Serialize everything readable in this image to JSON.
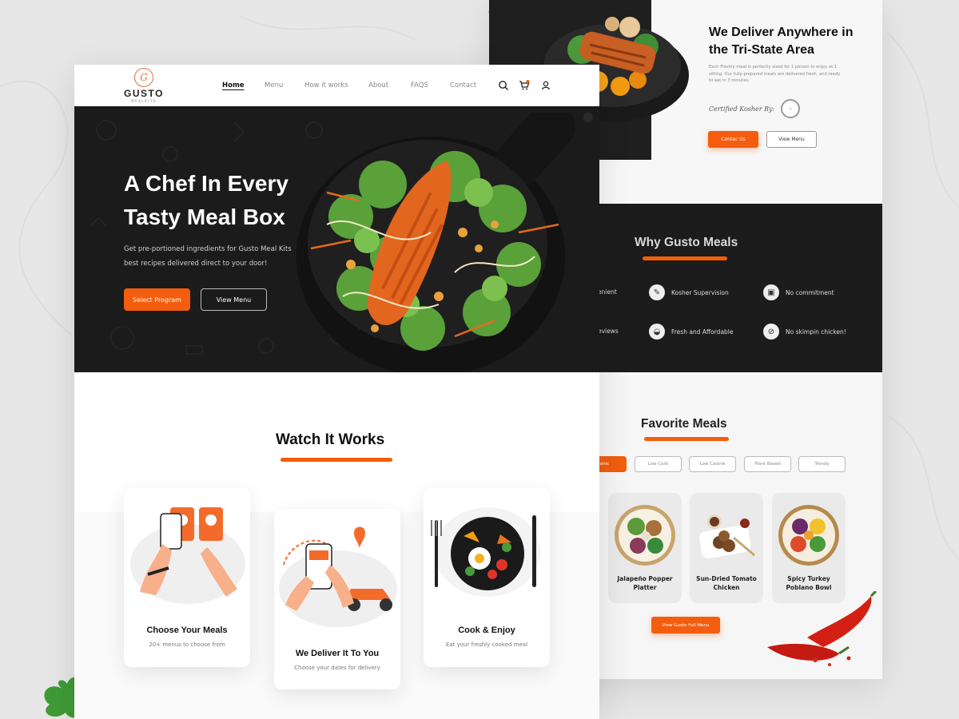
{
  "colors": {
    "accent": "#f35d0d",
    "dark": "#1b1b1b",
    "background": "#e7e7e7"
  },
  "brand": {
    "initial": "G",
    "name": "GUSTO",
    "tagline": "MEALKITS"
  },
  "nav": {
    "links": [
      "Home",
      "Menu",
      "How it works",
      "About",
      "FAQS",
      "Contact"
    ],
    "active": "Home",
    "icons": [
      "search-icon",
      "cart-icon",
      "user-icon"
    ]
  },
  "hero": {
    "title": "A Chef In Every Tasty Meal Box",
    "subtitle": "Get pre-portioned ingredients for Gusto Meal Kits best recipes delivered direct to your door!",
    "primary_button": "Select Program",
    "secondary_button": "View Menu"
  },
  "watch": {
    "title": "Watch It Works",
    "steps": [
      {
        "title": "Choose Your Meals",
        "subtitle": "20+ menus to choose from"
      },
      {
        "title": "We Deliver It To You",
        "subtitle": "Choose your dates for delivery"
      },
      {
        "title": "Cook & Enjoy",
        "subtitle": "Eat your freshly cooked meal"
      }
    ]
  },
  "deliver": {
    "title": "We Deliver Anywhere in the Tri-State Area",
    "description": "Each Freshly meal is perfectly sized for 1 person to enjoy at 1 sitting. Our fully-prepared meals are delivered fresh, and ready to eat in 3 minutes.",
    "kosher_label": "Certified Kosher By:",
    "contact_button": "Contac Us",
    "menu_button": "View Menu"
  },
  "why": {
    "title": "Why Gusto Meals",
    "items": [
      {
        "label": "enient",
        "icon": "convenient-icon"
      },
      {
        "label": "Kosher Supervision",
        "icon": "kosher-icon"
      },
      {
        "label": "No commitment",
        "icon": "calendar-icon"
      },
      {
        "label": "eviews",
        "icon": "reviews-icon"
      },
      {
        "label": "Fresh and Affordable",
        "icon": "fresh-icon"
      },
      {
        "label": "No skimpin chicken!",
        "icon": "chicken-icon"
      }
    ]
  },
  "favorites": {
    "title": "Favorite Meals",
    "filters": [
      "ogenic",
      "Low Carb",
      "Low Calorie",
      "Plant Based",
      "Trendy"
    ],
    "active_filter": "ogenic",
    "meals": [
      {
        "name": "Jalapeño Popper Platter"
      },
      {
        "name": "Sun-Dried Tomato Chicken"
      },
      {
        "name": "Spicy Turkey Poblano Bowl"
      }
    ],
    "cta": "View Gusto Full Menu"
  }
}
